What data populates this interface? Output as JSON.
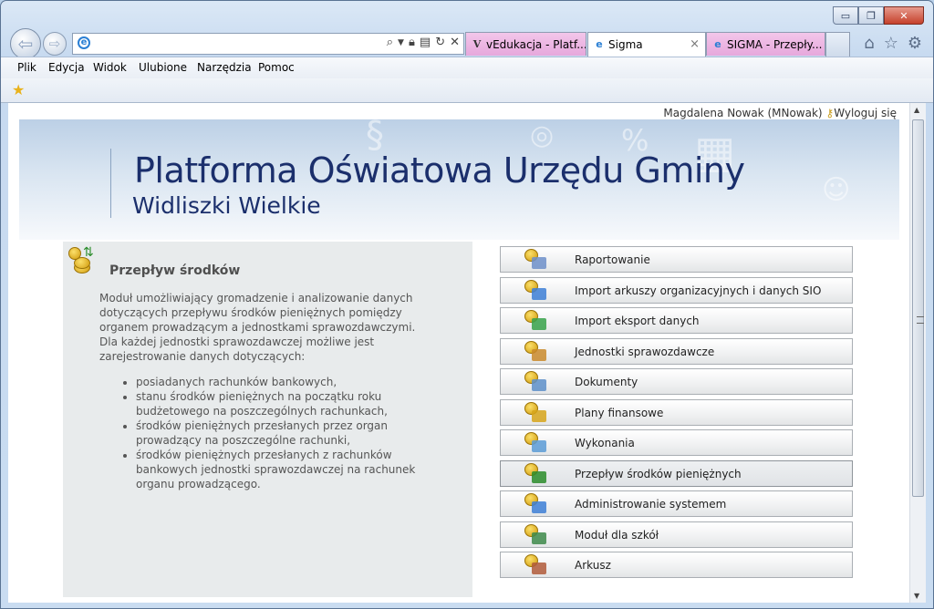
{
  "window": {
    "caption_buttons": {
      "minimize": "▭",
      "maximize": "❐",
      "close": "✕"
    }
  },
  "browser": {
    "address_value": "",
    "tabs": [
      {
        "label": "vEdukacja - Platf...",
        "icon": "V"
      },
      {
        "label": "Sigma",
        "icon": "e"
      },
      {
        "label": "SIGMA - Przepły...",
        "icon": "e"
      }
    ],
    "close_tab": "×",
    "menu": [
      "Plik",
      "Edycja",
      "Widok",
      "Ulubione",
      "Narzędzia",
      "Pomoc"
    ]
  },
  "page": {
    "user": "Magdalena Nowak (MNowak)",
    "logout": "Wyloguj się",
    "title": "Platforma Oświatowa Urzędu Gminy",
    "subtitle": "Widliszki Wielkie",
    "module": {
      "title": "Przepływ środków",
      "description": "Moduł umożliwiający gromadzenie i analizowanie danych dotyczących przepływu środków pieniężnych pomiędzy organem prowadzącym a jednostkami sprawozdawczymi. Dla każdej jednostki sprawozdawczej możliwe jest zarejestrowanie danych dotyczących:",
      "items": [
        "posiadanych rachunków bankowych,",
        "stanu środków pieniężnych na początku roku budżetowego na poszczególnych rachunkach,",
        "środków pieniężnych przesłanych przez organ prowadzący na poszczególne rachunki,",
        "środków pieniężnych przesłanych z rachunków bankowych jednostki sprawozdawczej na rachunek organu prowadzącego."
      ]
    },
    "menu": [
      {
        "label": "Raportowanie",
        "icon": "report-icon"
      },
      {
        "label": "Import arkuszy organizacyjnych i danych SIO",
        "icon": "import-sheets-icon"
      },
      {
        "label": "Import eksport danych",
        "icon": "import-export-icon"
      },
      {
        "label": "Jednostki sprawozdawcze",
        "icon": "units-icon"
      },
      {
        "label": "Dokumenty",
        "icon": "documents-icon"
      },
      {
        "label": "Plany finansowe",
        "icon": "financial-plans-icon"
      },
      {
        "label": "Wykonania",
        "icon": "executions-icon"
      },
      {
        "label": "Przepływ środków pieniężnych",
        "icon": "cash-flow-icon",
        "active": true
      },
      {
        "label": "Administrowanie systemem",
        "icon": "admin-gears-icon"
      },
      {
        "label": "Moduł dla szkół",
        "icon": "school-module-icon"
      },
      {
        "label": "Arkusz",
        "icon": "sheet-icon"
      }
    ]
  }
}
